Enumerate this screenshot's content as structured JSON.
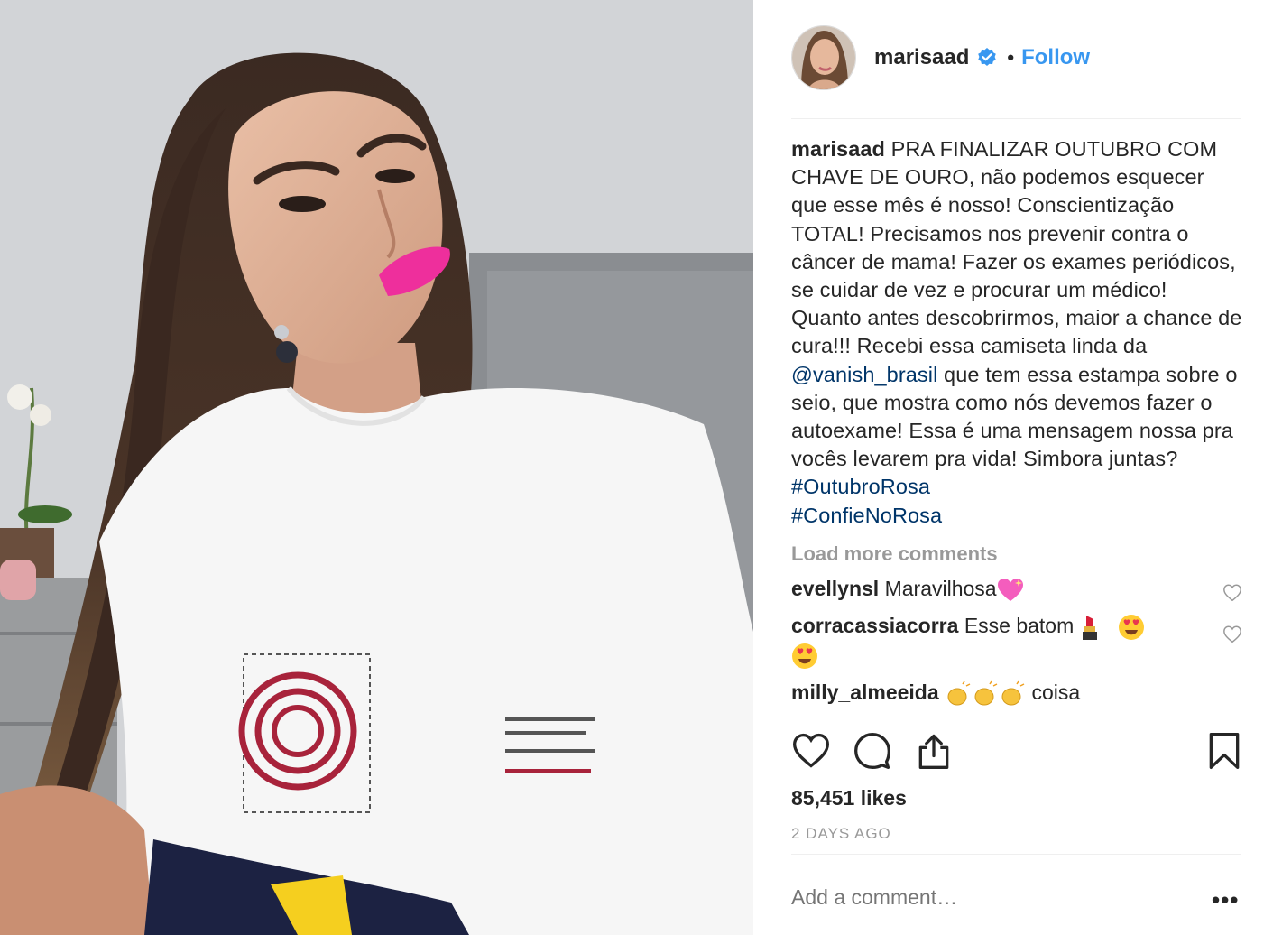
{
  "header": {
    "username": "marisaad",
    "separator": "•",
    "follow_label": "Follow"
  },
  "caption": {
    "username": "marisaad",
    "text_before": "PRA FINALIZAR OUTUBRO COM CHAVE DE OURO, não podemos esquecer que esse mês é nosso! Conscientização TOTAL! Precisamos nos prevenir contra o câncer de mama! Fazer os exames periódicos, se cuidar de vez e procurar um médico! Quanto antes descobrirmos, maior a chance de cura!!! Recebi essa camiseta linda da ",
    "mention": "@vanish_brasil",
    "text_after": " que tem essa estampa sobre o seio, que mostra como nós devemos fazer o autoexame! Essa é uma mensagem nossa pra vocês levarem pra vida! Simbora juntas? ",
    "hashtag1": "#OutubroRosa",
    "hashtag2": "#ConfieNoRosa"
  },
  "load_more_label": "Load more comments",
  "comments": [
    {
      "username": "evellynsl",
      "text": "Maravilhosa"
    },
    {
      "username": "corracassiacorra",
      "text": "Esse batom"
    },
    {
      "username": "milly_almeeida",
      "text": "coisa"
    }
  ],
  "likes": "85,451 likes",
  "timestamp": "2 DAYS AGO",
  "add_comment_placeholder": "Add a comment…",
  "more_label": "•••",
  "colors": {
    "link": "#003569",
    "follow": "#3897f0",
    "muted": "#999999",
    "lipstick": "#ee2f9c"
  },
  "icons": [
    "verified-badge-icon",
    "heart-icon",
    "comment-icon",
    "share-icon",
    "bookmark-icon"
  ]
}
